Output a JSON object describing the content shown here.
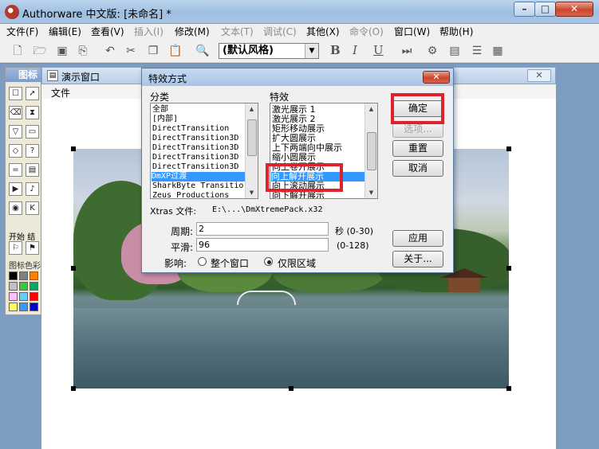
{
  "window": {
    "title": "Authorware 中文版: [未命名] *"
  },
  "menubar": [
    {
      "label": "文件(F)",
      "enabled": true
    },
    {
      "label": "编辑(E)",
      "enabled": true
    },
    {
      "label": "查看(V)",
      "enabled": true
    },
    {
      "label": "插入(I)",
      "enabled": false
    },
    {
      "label": "修改(M)",
      "enabled": true
    },
    {
      "label": "文本(T)",
      "enabled": false
    },
    {
      "label": "调试(C)",
      "enabled": false
    },
    {
      "label": "其他(X)",
      "enabled": true
    },
    {
      "label": "命令(O)",
      "enabled": false
    },
    {
      "label": "窗口(W)",
      "enabled": true
    },
    {
      "label": "帮助(H)",
      "enabled": true
    }
  ],
  "toolbar": {
    "style_value": "(默认风格)",
    "bold": "B",
    "italic": "I",
    "underline": "U"
  },
  "palette": {
    "title": "图标",
    "start_label": "开始",
    "end_label": "结",
    "color_label": "图标色彩"
  },
  "presentation": {
    "title": "演示窗口",
    "menu_file": "文件"
  },
  "dialog": {
    "title": "特效方式",
    "category_label": "分类",
    "effect_label": "特效",
    "categories": [
      "全部",
      "[内部]",
      "DirectTransition",
      "DirectTransition3D",
      "DirectTransition3D",
      "DirectTransition3D",
      "DirectTransition3D",
      "DmXP过渡",
      "SharkByte Transitio",
      "Zeus Productions"
    ],
    "category_selected": 7,
    "effects": [
      "激光展示 1",
      "激光展示 2",
      "矩形移动展示",
      "扩大圆展示",
      "上下两端向中展示",
      "缩小圆展示",
      "向上卷开展示",
      "向上解开展示",
      "向上滚动展示",
      "向下解开展示"
    ],
    "effect_selected": 7,
    "buttons": {
      "ok": "确定",
      "options": "选项...",
      "reset": "重置",
      "cancel": "取消",
      "apply": "应用",
      "about": "关于..."
    },
    "xtras_label": "Xtras 文件:",
    "xtras_value": "E:\\...\\DmXtremePack.x32",
    "period_label": "周期:",
    "period_value": "2",
    "period_unit": "秒 (0-30)",
    "smooth_label": "平滑:",
    "smooth_value": "96",
    "smooth_range": "(0-128)",
    "affect_label": "影响:",
    "affect_whole": "整个窗口",
    "affect_region": "仅限区域",
    "affect_selected": "region"
  },
  "colors": {
    "accent": "#3399ff",
    "highlight_box": "#e0202a"
  }
}
